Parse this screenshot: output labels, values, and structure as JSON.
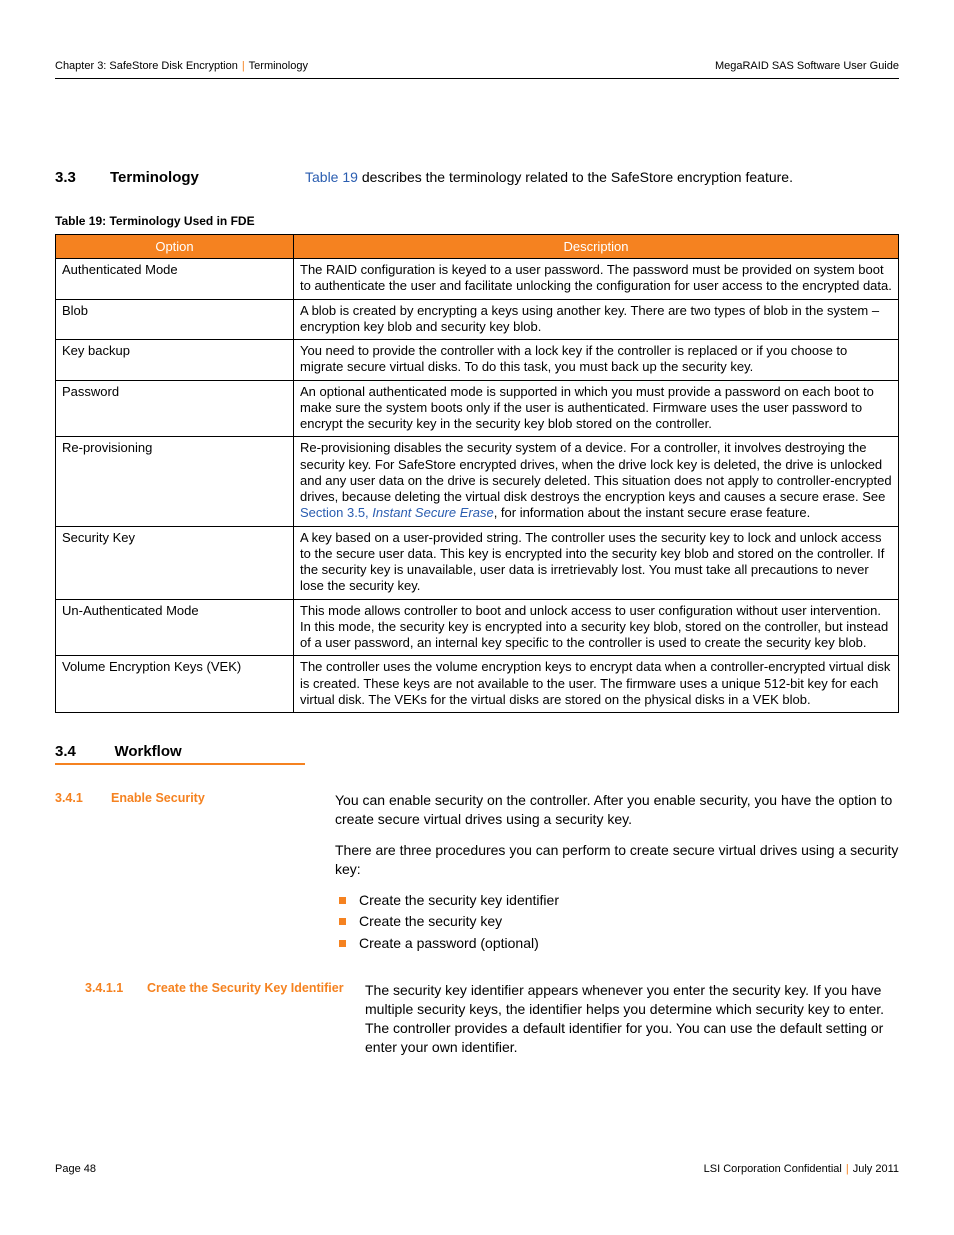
{
  "header": {
    "chapter": "Chapter 3: SafeStore Disk Encryption",
    "section": "Terminology",
    "doc_title": "MegaRAID SAS Software User Guide"
  },
  "sec33": {
    "num": "3.3",
    "title": "Terminology",
    "intro_link": "Table 19",
    "intro_rest": " describes the terminology related to the SafeStore encryption feature."
  },
  "table": {
    "caption": "Table 19:   Terminology Used in FDE",
    "head_option": "Option",
    "head_desc": "Description",
    "rows": [
      {
        "opt": "Authenticated Mode",
        "desc": "The RAID configuration is keyed to a user password. The password must be provided on system boot to authenticate the user and facilitate unlocking the configuration for user access to the encrypted data."
      },
      {
        "opt": "Blob",
        "desc": "A blob is created by encrypting a keys using another key. There are two types of blob in the system – encryption key blob and security key blob."
      },
      {
        "opt": "Key backup",
        "desc": "You need to provide the controller with a lock key if the controller is replaced or if you choose to migrate secure virtual disks. To do this task, you must back up the security key."
      },
      {
        "opt": "Password",
        "desc": "An optional authenticated mode is supported in which you must provide a password on each boot to make sure the system boots only if the user is authenticated. Firmware uses the user password to encrypt the security key in the security key blob stored on the controller."
      },
      {
        "opt": "Re-provisioning",
        "desc_pre": "Re-provisioning disables the security system of a device. For a controller, it involves destroying the security key. For SafeStore encrypted drives, when the drive lock key is deleted, the drive is unlocked and any user data on the drive is securely deleted. This situation does not apply to controller-encrypted drives, because deleting the virtual disk destroys the encryption keys and causes a secure erase. See ",
        "link1": "Section 3.5, ",
        "link2": "Instant Secure Erase",
        "desc_post": ", for information about the instant secure erase feature."
      },
      {
        "opt": "Security Key",
        "desc": "A key based on a user-provided string. The controller uses the security key to lock and unlock access to the secure user data. This key is encrypted into the security key blob and stored on the controller. If the security key is unavailable, user data is irretrievably lost. You must take all precautions to never lose the security key."
      },
      {
        "opt": "Un-Authenticated Mode",
        "desc": "This mode allows controller to boot and unlock access to user configuration without user intervention. In this mode, the security key is encrypted into a security key blob, stored on the controller, but instead of a user password, an internal key specific to the controller is used to create the security key blob."
      },
      {
        "opt": "Volume Encryption Keys (VEK)",
        "desc": "The controller uses the volume encryption keys to encrypt data when a controller-encrypted virtual disk is created. These keys are not available to the user. The firmware uses a unique 512-bit key for each virtual disk. The VEKs for the virtual disks are stored on the physical disks in a VEK blob."
      }
    ]
  },
  "sec34": {
    "num": "3.4",
    "title": "Workflow"
  },
  "sec341": {
    "num": "3.4.1",
    "title": "Enable Security",
    "p1": "You can enable security on the controller. After you enable security, you have the option to create secure virtual drives using a security key.",
    "p2": "There are three procedures you can perform to create secure virtual drives using a security key:",
    "bullets": [
      "Create the security key identifier",
      "Create the security key",
      "Create a password (optional)"
    ]
  },
  "sec3411": {
    "num": "3.4.1.1",
    "title": "Create the Security Key Identifier",
    "p1": "The security key identifier appears whenever you enter the security key. If you have multiple security keys, the identifier helps you determine which security key to enter. The controller provides a default identifier for you. You can use the default setting or enter your own identifier."
  },
  "footer": {
    "page": "Page 48",
    "conf": "LSI Corporation Confidential",
    "date": "July 2011"
  }
}
